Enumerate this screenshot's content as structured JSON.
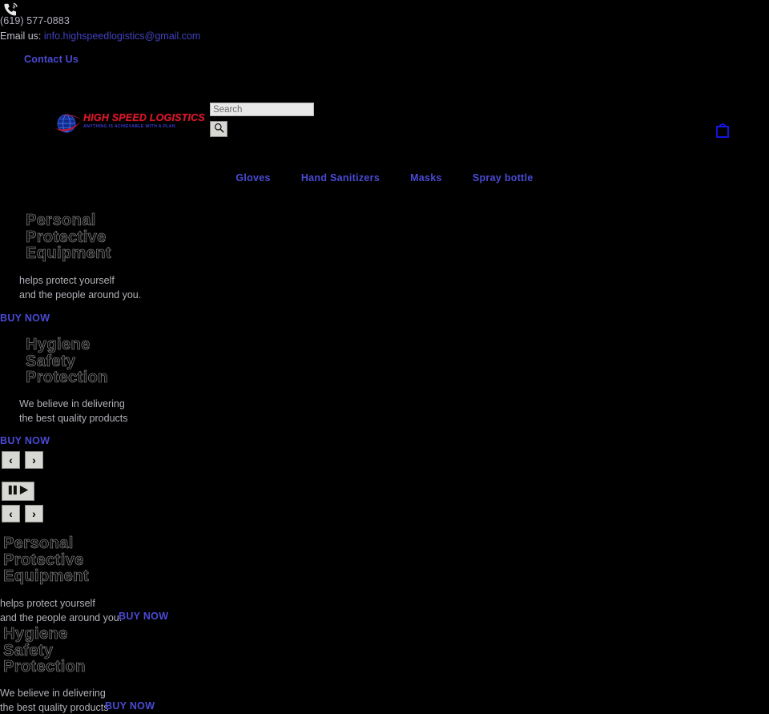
{
  "topbar": {
    "phone_icon": "phone-ringing-icon",
    "phone": "(619) 577-0883",
    "email_label": "Email us:",
    "email": "info.highspeedlogistics@gmail.com",
    "contact_link": "Contact Us"
  },
  "header": {
    "logo_text": "HIGH SPEED LOGISTICS",
    "logo_tagline": "ANYTHING IS ACHIEVABLE WITH A PLAN",
    "logo_icon": "globe-swoosh-icon",
    "cart_icon": "shopping-cart-icon"
  },
  "search": {
    "value": "",
    "placeholder": "Search",
    "button_icon": "search-icon"
  },
  "nav": {
    "items": [
      {
        "label": "Gloves"
      },
      {
        "label": "Hand Sanitizers"
      },
      {
        "label": "Masks"
      },
      {
        "label": "Spray bottle"
      }
    ]
  },
  "slides": [
    {
      "heading": "Personal\nProtective\nEquipment",
      "subtitle": "helps protect yourself\nand the people around you.",
      "cta": "BUY NOW"
    },
    {
      "heading": "Hygiene\nSafety\nProtection",
      "subtitle": "We believe in delivering\nthe best quality products",
      "cta": "BUY NOW"
    }
  ],
  "carousel": {
    "prev_label": "‹",
    "next_label": "›",
    "pause_label": "▐▐ ▶"
  },
  "bottom_blocks": [
    {
      "heading": "Personal\nProtective\nEquipment",
      "subtitle": "helps protect yourself\nand the people around you.",
      "cta": "BUY NOW"
    },
    {
      "heading": "Hygiene\nSafety\nProtection",
      "subtitle": "We believe in delivering\nthe best quality products",
      "cta": "BUY NOW"
    }
  ],
  "colors": {
    "background": "#000000",
    "link": "#4a4ad6",
    "logo_red": "#d6192b",
    "logo_blue": "#3a3ad0",
    "control_face": "#d7d7d3"
  }
}
